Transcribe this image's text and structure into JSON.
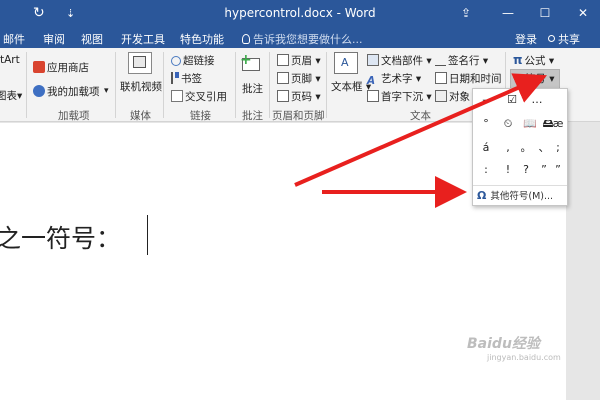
{
  "window": {
    "title": "hypercontrol.docx - Word",
    "controls": {
      "ribbon_display": "⇪",
      "minimize": "—",
      "restore": "☐",
      "close": "✕"
    }
  },
  "quick_access": {
    "refresh": "↻",
    "dropdown": "⇣"
  },
  "menu": {
    "tabs": [
      "邮件",
      "审阅",
      "视图",
      "开发工具",
      "特色功能"
    ],
    "tell_me_placeholder": "告诉我您想要做什么...",
    "login": "登录",
    "share": "共享"
  },
  "ribbon": {
    "smartart_partial": "tArt",
    "chart_partial": "图表",
    "chart_dropdown": "▾",
    "addins": {
      "store": "应用商店",
      "my_addins": "我的加载项",
      "group": "加载项"
    },
    "media": {
      "online_video_line1": "联机视频",
      "group": "媒体"
    },
    "links": {
      "hyperlink": "超链接",
      "bookmark": "书签",
      "cross_ref": "交叉引用",
      "group": "链接"
    },
    "comments": {
      "comment": "批注",
      "group": "批注"
    },
    "header_footer": {
      "header": "页眉",
      "footer": "页脚",
      "page_number": "页码",
      "group": "页眉和页脚"
    },
    "text": {
      "textbox": "文本框",
      "quick_parts": "文档部件",
      "wordart": "艺术字",
      "dropcap": "首字下沉",
      "signature": "签名行",
      "datetime": "日期和时间",
      "object": "对象",
      "group": "文本"
    },
    "symbols": {
      "equation": "公式",
      "symbol": "符号"
    }
  },
  "document": {
    "text": "之一符号："
  },
  "symbol_panel": {
    "symbols": [
      "–",
      "☑",
      "…",
      "°",
      "⏲",
      "📖",
      "🖴",
      "æ",
      "á",
      ",",
      "。",
      "、",
      ";",
      ":",
      "!",
      "?",
      "”",
      "”"
    ],
    "more_label": "其他符号(M)..."
  },
  "watermark": {
    "text": "Baidu经验",
    "sub": "jingyan.baidu.com"
  },
  "colors": {
    "accent": "#2b579a",
    "arrow": "#e8201e",
    "ribbon": "#f3f3f3"
  }
}
